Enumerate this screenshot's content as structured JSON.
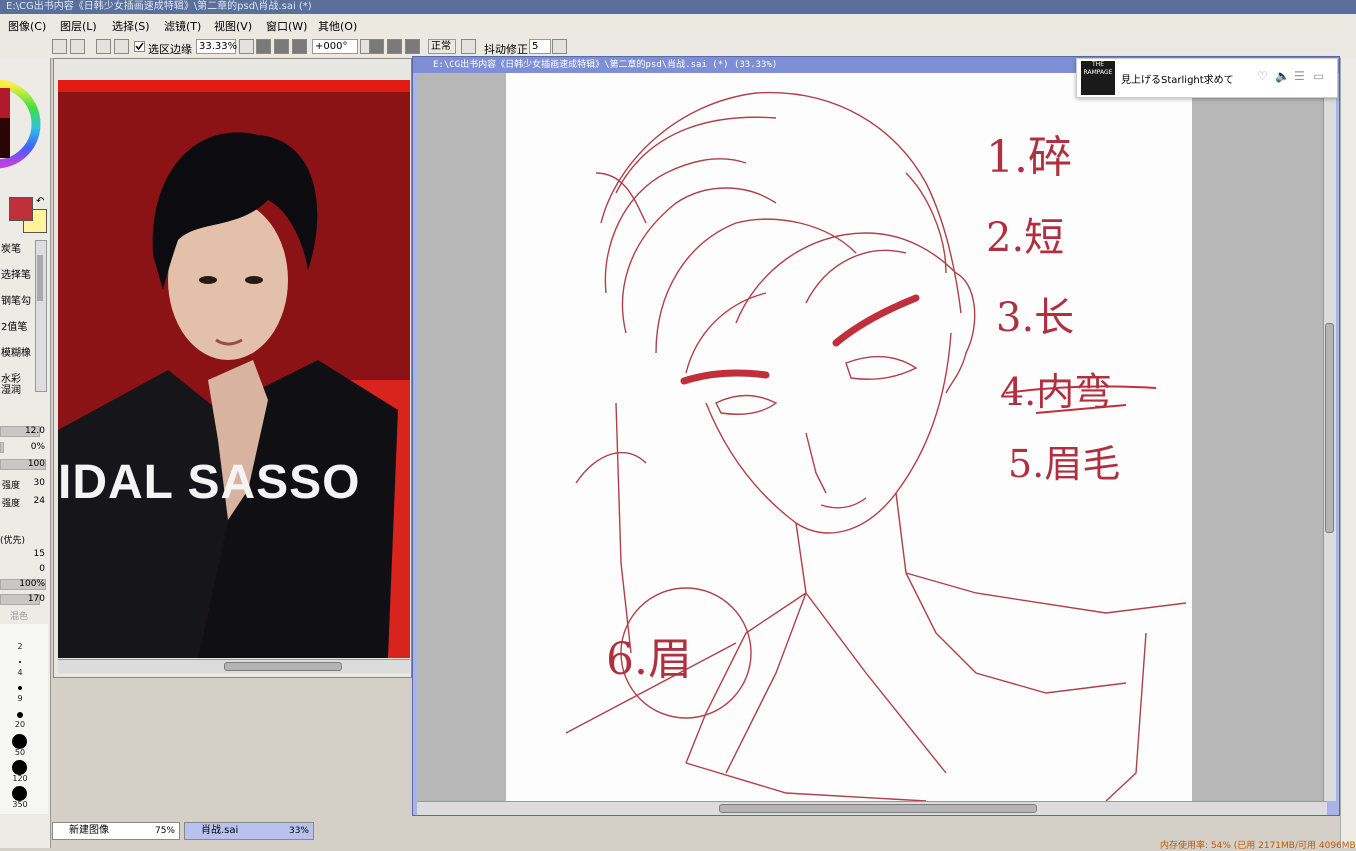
{
  "titlebar": {
    "text": "E:\\CG出书内容《日韩少女插画速成特辑》\\第二章的psd\\肖战.sai (*)"
  },
  "menu": [
    "图像(C)",
    "图层(L)",
    "选择(S)",
    "滤镜(T)",
    "视图(V)",
    "窗口(W)",
    "其他(O)"
  ],
  "toolbar": {
    "selection_edge_label": "选区边缘",
    "selection_edge_checked": true,
    "zoom": "33.33%",
    "rotation": "+000°",
    "blend_mode": "正常",
    "stabilizer_label": "抖动修正",
    "stabilizer_value": "5"
  },
  "colors": {
    "primary": "#c0303a",
    "secondary": "#fff49a",
    "canvas_caption": "#7e8fd6",
    "line_art": "#b0404a"
  },
  "tools": [
    "炭笔",
    "选择笔",
    "钢笔勾",
    "2值笔",
    "模糊橡",
    "水彩",
    "湿润"
  ],
  "params": {
    "size": "12.0",
    "min_size": "0%",
    "density": "100",
    "strength1_label": "强度",
    "strength1": "30",
    "strength2_label": "强度",
    "strength2": "24",
    "priority_label": "(优先)",
    "v1": "15",
    "v2": "0",
    "v3": "100%",
    "v4": "170",
    "mix_label": "混色"
  },
  "brush_sizes": [
    "2",
    "4",
    "9",
    "20",
    "50",
    "120",
    "350"
  ],
  "ref_window": {
    "ad_text": "IDAL SASSO"
  },
  "doc_tabs": [
    {
      "name": "新建图像",
      "zoom": "75%"
    },
    {
      "name": "肖战.sai",
      "zoom": "33%"
    }
  ],
  "main_window": {
    "caption": "E:\\CG出书内容《日韩少女插画速成特辑》\\第二章的psd\\肖战.sai (*) (33.33%)"
  },
  "annotations": [
    "1.碎",
    "2.短",
    "3.长",
    "4.内弯",
    "5.眉毛",
    "6.眉"
  ],
  "popup": {
    "album_label": "THE RAMPAGE",
    "song": "見上げるStarlight求めて"
  },
  "status": {
    "text": "内存使用率: 54% (已用 2171MB/可用 4096MB)"
  }
}
